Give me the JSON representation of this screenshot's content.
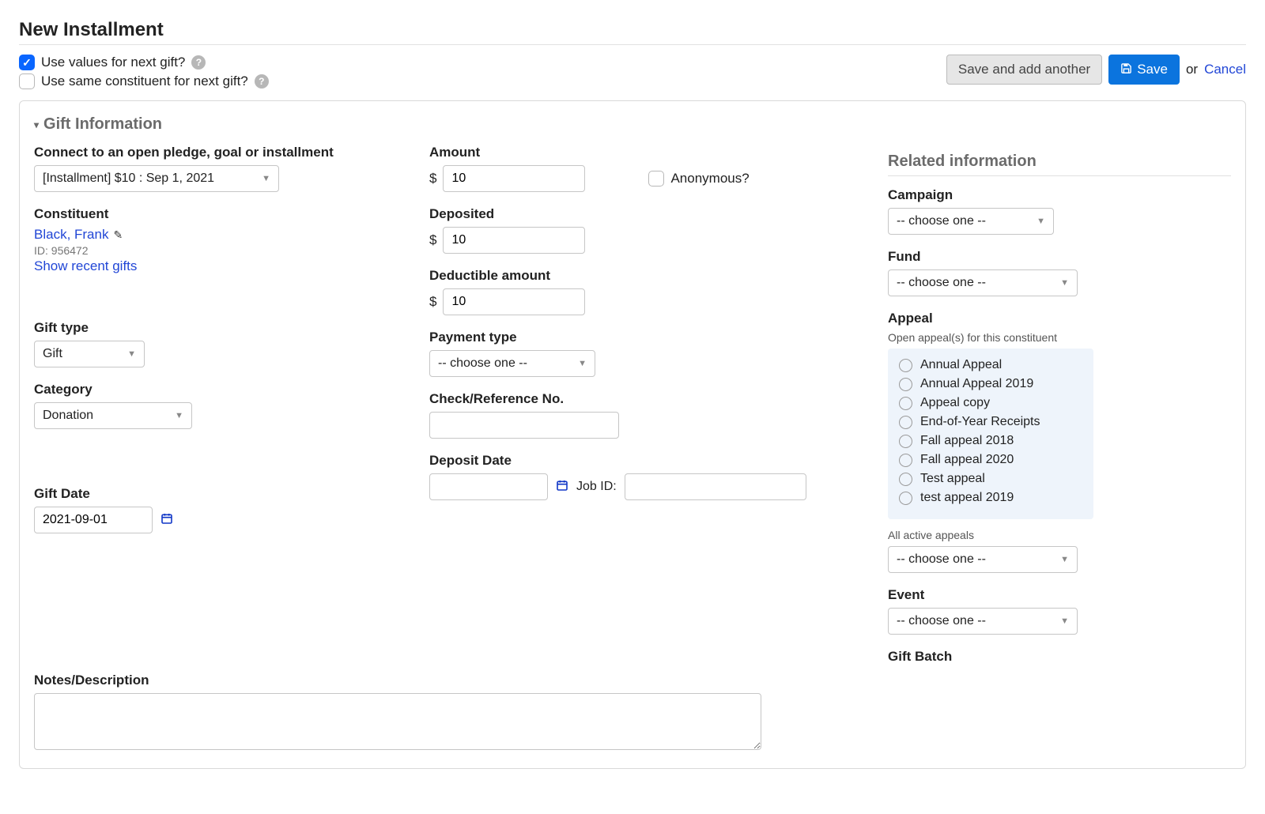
{
  "page": {
    "title": "New Installment"
  },
  "topOptions": {
    "useValuesNext": {
      "label": "Use values for next gift?",
      "checked": true
    },
    "useSameConstituent": {
      "label": "Use same constituent for next gift?",
      "checked": false
    }
  },
  "actions": {
    "saveAddAnother": "Save and add another",
    "save": "Save",
    "or": "or",
    "cancel": "Cancel"
  },
  "section": {
    "giftInfo": "Gift Information"
  },
  "left": {
    "connectLabel": "Connect to an open pledge, goal or installment",
    "connectValue": "[Installment] $10 : Sep 1, 2021",
    "constituentLabel": "Constituent",
    "constituentName": "Black, Frank",
    "constituentId": "ID: 956472",
    "showRecent": "Show recent gifts",
    "giftTypeLabel": "Gift type",
    "giftTypeValue": "Gift",
    "categoryLabel": "Category",
    "categoryValue": "Donation",
    "giftDateLabel": "Gift Date",
    "giftDateValue": "2021-09-01",
    "notesLabel": "Notes/Description",
    "notesValue": ""
  },
  "mid": {
    "amountLabel": "Amount",
    "amountValue": "10",
    "currency": "$",
    "anonymousLabel": "Anonymous?",
    "depositedLabel": "Deposited",
    "depositedValue": "10",
    "deductibleLabel": "Deductible amount",
    "deductibleValue": "10",
    "paymentTypeLabel": "Payment type",
    "paymentTypeValue": "-- choose one --",
    "checkRefLabel": "Check/Reference No.",
    "checkRefValue": "",
    "depositDateLabel": "Deposit Date",
    "depositDateValue": "",
    "jobIdLabel": "Job ID:",
    "jobIdValue": ""
  },
  "right": {
    "title": "Related information",
    "campaignLabel": "Campaign",
    "campaignValue": "-- choose one --",
    "fundLabel": "Fund",
    "fundValue": "-- choose one --",
    "appealLabel": "Appeal",
    "openAppealsSub": "Open appeal(s) for this constituent",
    "appeals": [
      "Annual Appeal",
      "Annual Appeal 2019",
      "Appeal copy",
      "End-of-Year Receipts",
      "Fall appeal 2018",
      "Fall appeal 2020",
      "Test appeal",
      "test appeal 2019"
    ],
    "allActiveSub": "All active appeals",
    "allActiveValue": "-- choose one --",
    "eventLabel": "Event",
    "eventValue": "-- choose one --",
    "giftBatchLabel": "Gift Batch"
  }
}
